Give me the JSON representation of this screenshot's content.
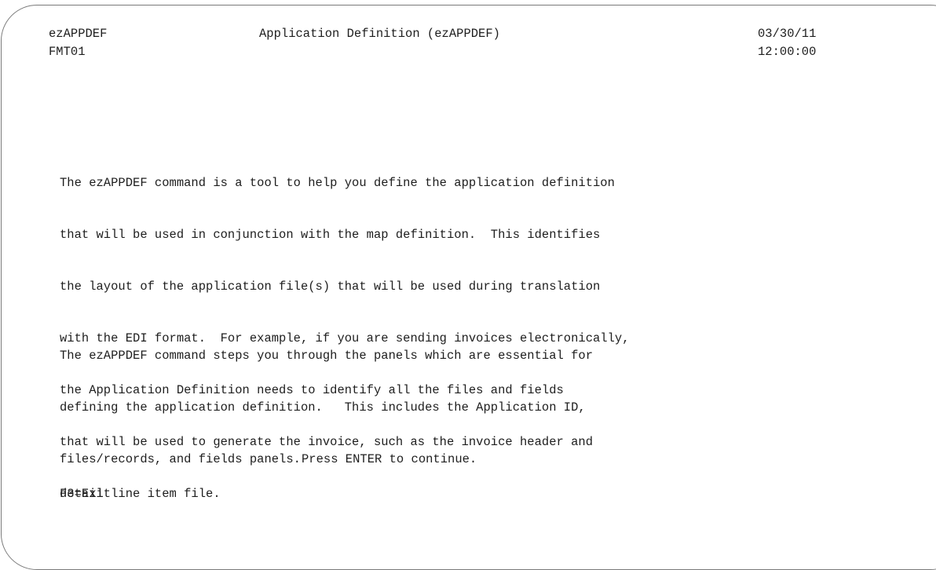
{
  "header": {
    "program_name": "ezAPPDEF",
    "title": "Application Definition (ezAPPDEF)",
    "date": "03/30/11",
    "format_id": "FMT01",
    "time": "12:00:00"
  },
  "description": {
    "paragraph_1": [
      "The ezAPPDEF command is a tool to help you define the application definition",
      "that will be used in conjunction with the map definition.  This identifies",
      "the layout of the application file(s) that will be used during translation",
      "with the EDI format.  For example, if you are sending invoices electronically,",
      "the Application Definition needs to identify all the files and fields",
      "that will be used to generate the invoice, such as the invoice header and",
      "detail line item file."
    ],
    "paragraph_2": [
      "The ezAPPDEF command steps you through the panels which are essential for",
      "defining the application definition.   This includes the Application ID,",
      "files/records, and fields panels."
    ]
  },
  "prompt": "Press ENTER to continue.",
  "function_keys": {
    "f3": "F3=Exit"
  }
}
